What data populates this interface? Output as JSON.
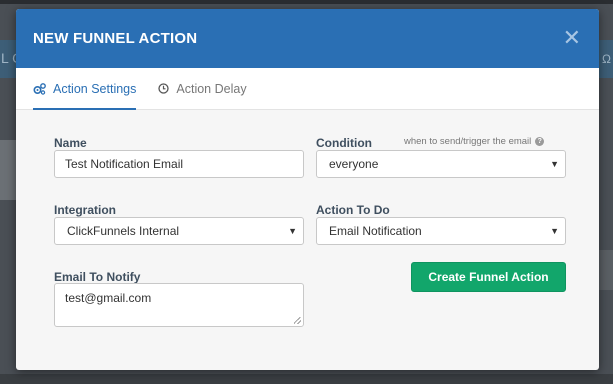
{
  "background": {
    "edge_letter": "L C",
    "edge_mark": "Ω"
  },
  "modal": {
    "title": "NEW FUNNEL ACTION",
    "close_symbol": "✕"
  },
  "tabs": [
    {
      "label": "Action Settings",
      "icon": "gears-icon",
      "active": true
    },
    {
      "label": "Action Delay",
      "icon": "clock-icon",
      "active": false
    }
  ],
  "form": {
    "name": {
      "label": "Name",
      "value": "Test Notification Email"
    },
    "condition": {
      "label": "Condition",
      "hint": "when to send/trigger the email",
      "hint_icon": "?",
      "value": "everyone"
    },
    "integration": {
      "label": "Integration",
      "value": "ClickFunnels Internal"
    },
    "action_to_do": {
      "label": "Action To Do",
      "value": "Email Notification"
    },
    "email_to_notify": {
      "label": "Email To Notify",
      "value": "test@gmail.com"
    },
    "submit_label": "Create Funnel Action"
  },
  "colors": {
    "header": "#2a6fb4",
    "accent": "#2a6fb4",
    "button": "#12a66b"
  }
}
